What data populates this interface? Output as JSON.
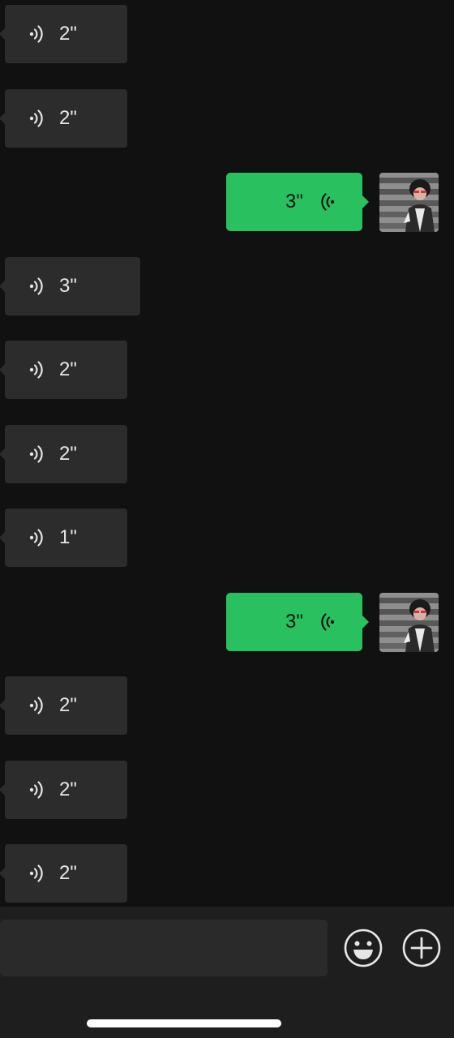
{
  "messages": [
    {
      "side": "in",
      "duration": "2\""
    },
    {
      "side": "in",
      "duration": "2\""
    },
    {
      "side": "out",
      "duration": "3\""
    },
    {
      "side": "in",
      "duration": "3\""
    },
    {
      "side": "in",
      "duration": "2\""
    },
    {
      "side": "in",
      "duration": "2\""
    },
    {
      "side": "in",
      "duration": "1\""
    },
    {
      "side": "out",
      "duration": "3\""
    },
    {
      "side": "in",
      "duration": "2\""
    },
    {
      "side": "in",
      "duration": "2\""
    },
    {
      "side": "in",
      "duration": "2\""
    }
  ],
  "input_bar": {
    "text_value": "",
    "emoji_icon": "emoji-icon",
    "plus_icon": "plus-circle-icon"
  },
  "colors": {
    "background": "#111111",
    "incoming_bubble": "#2c2c2c",
    "outgoing_bubble": "#29c15f",
    "input_bar": "#1e1e1e"
  }
}
